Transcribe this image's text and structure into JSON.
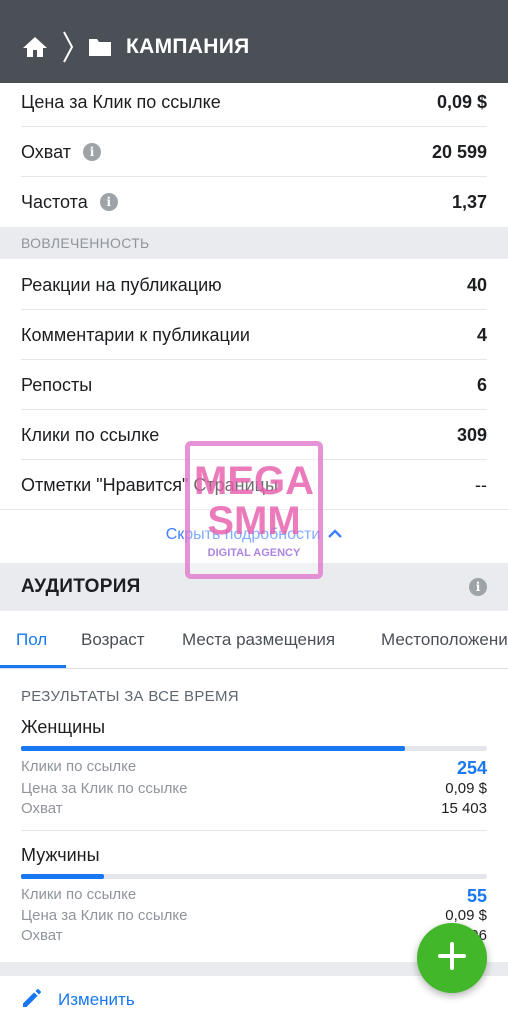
{
  "header": {
    "title": "КАМПАНИЯ",
    "home_icon": "home-icon",
    "chevron_icon": "chevron-right-icon",
    "folder_icon": "folder-icon"
  },
  "metrics_top": [
    {
      "label": "Цена за Клик по ссылке",
      "value": "0,09 $",
      "info": false
    },
    {
      "label": "Охват",
      "value": "20 599",
      "info": true
    },
    {
      "label": "Частота",
      "value": "1,37",
      "info": true
    }
  ],
  "engagement": {
    "section_label": "ВОВЛЕЧЕННОСТЬ",
    "rows": [
      {
        "label": "Реакции на публикацию",
        "value": "40"
      },
      {
        "label": "Комментарии к публикации",
        "value": "4"
      },
      {
        "label": "Репосты",
        "value": "6"
      },
      {
        "label": "Клики по ссылке",
        "value": "309"
      },
      {
        "label": "Отметки \"Нравится\" Страницы",
        "value": "--"
      }
    ]
  },
  "hide_details": {
    "label": "Скрыть подробности",
    "icon": "chevron-up-icon"
  },
  "audience": {
    "title": "АУДИТОРИЯ",
    "tabs": [
      "Пол",
      "Возраст",
      "Места размещения",
      "Местоположение"
    ],
    "active_tab": "Пол",
    "results_label": "РЕЗУЛЬТАТЫ ЗА ВСЕ ВРЕМЯ",
    "groups": [
      {
        "name": "Женщины",
        "share": 0.823,
        "clicks_label": "Клики по ссылке",
        "clicks": "254",
        "cpc_label": "Цена за Клик по ссылке",
        "cpc": "0,09 $",
        "reach_label": "Охват",
        "reach": "15 403"
      },
      {
        "name": "Мужчины",
        "share": 0.178,
        "clicks_label": "Клики по ссылке",
        "clicks": "55",
        "cpc_label": "Цена за Клик по ссылке",
        "cpc": "0,09 $",
        "reach_label": "Охват",
        "reach": "5 196"
      }
    ]
  },
  "edit": {
    "label": "Изменить",
    "icon": "pencil-icon"
  },
  "fab": {
    "icon": "plus-icon"
  },
  "watermark": {
    "line1": "MEGA",
    "line2": "SMM",
    "line3": "DIGITAL AGENCY"
  },
  "colors": {
    "header_bg": "#4b4f56",
    "accent": "#1877f2",
    "fab": "#42b72a",
    "section_bg": "#e9ebee"
  }
}
